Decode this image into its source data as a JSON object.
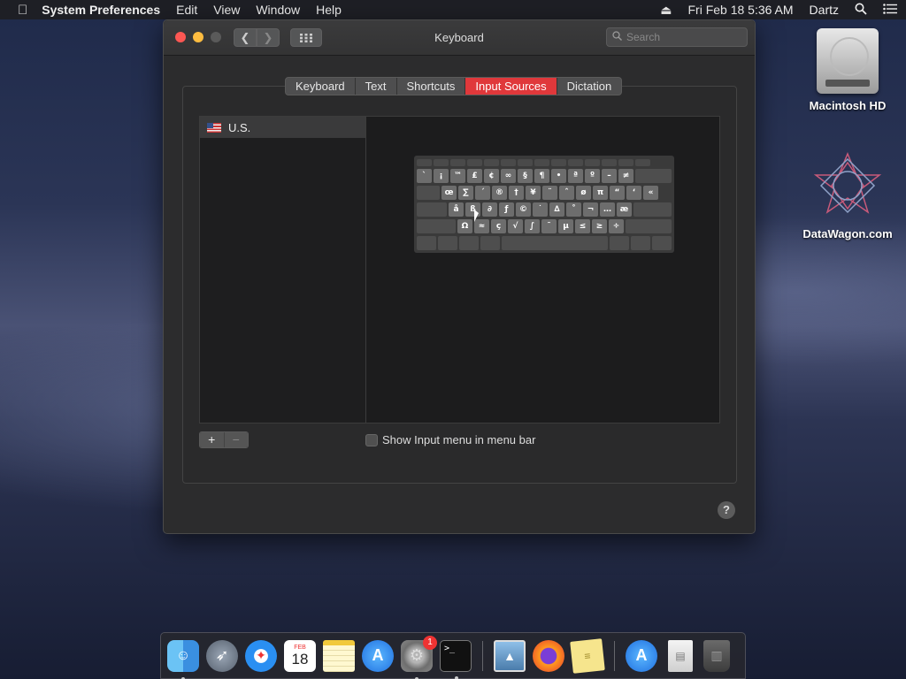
{
  "menubar": {
    "app_name": "System Preferences",
    "menus": [
      "Edit",
      "View",
      "Window",
      "Help"
    ],
    "datetime": "Fri Feb 18  5:36 AM",
    "user": "Dartz"
  },
  "window": {
    "title": "Keyboard",
    "search_placeholder": "Search",
    "tabs": [
      {
        "label": "Keyboard",
        "active": false
      },
      {
        "label": "Text",
        "active": false
      },
      {
        "label": "Shortcuts",
        "active": false
      },
      {
        "label": "Input Sources",
        "active": true
      },
      {
        "label": "Dictation",
        "active": false
      }
    ],
    "input_sources": [
      {
        "label": "U.S."
      }
    ],
    "add_label": "+",
    "remove_label": "−",
    "show_input_menu_label": "Show Input menu in menu bar",
    "show_input_menu_checked": false,
    "help_label": "?"
  },
  "keyboard_viewer": {
    "rows": [
      [
        "`",
        "¡",
        "™",
        "£",
        "¢",
        "∞",
        "§",
        "¶",
        "•",
        "ª",
        "º",
        "–",
        "≠",
        ""
      ],
      [
        "",
        "œ",
        "∑",
        "´",
        "®",
        "†",
        "¥",
        "¨",
        "ˆ",
        "ø",
        "π",
        "“",
        "‘",
        "«"
      ],
      [
        "",
        "å",
        "ß",
        "∂",
        "ƒ",
        "©",
        "˙",
        "∆",
        "˚",
        "¬",
        "…",
        "æ",
        ""
      ],
      [
        "",
        "Ω",
        "≈",
        "ç",
        "√",
        "∫",
        "˜",
        "µ",
        "≤",
        "≥",
        "÷",
        ""
      ]
    ]
  },
  "desktop": {
    "icons": [
      {
        "label": "Macintosh HD"
      },
      {
        "label": "DataWagon.com"
      }
    ]
  },
  "dock": {
    "apps": [
      "Finder",
      "Launchpad",
      "Safari",
      "Calendar",
      "Notes",
      "App Store",
      "System Preferences",
      "Terminal",
      "Preview",
      "Firefox",
      "Stickies",
      "App Store",
      "Document",
      "Trash"
    ],
    "calendar_month": "FEB",
    "calendar_day": "18",
    "sysprefs_badge": "1",
    "terminal_glyph": ">_"
  },
  "colors": {
    "accent_tab": "#e0383b",
    "close": "#fc5753",
    "minimize": "#fdbc40"
  }
}
